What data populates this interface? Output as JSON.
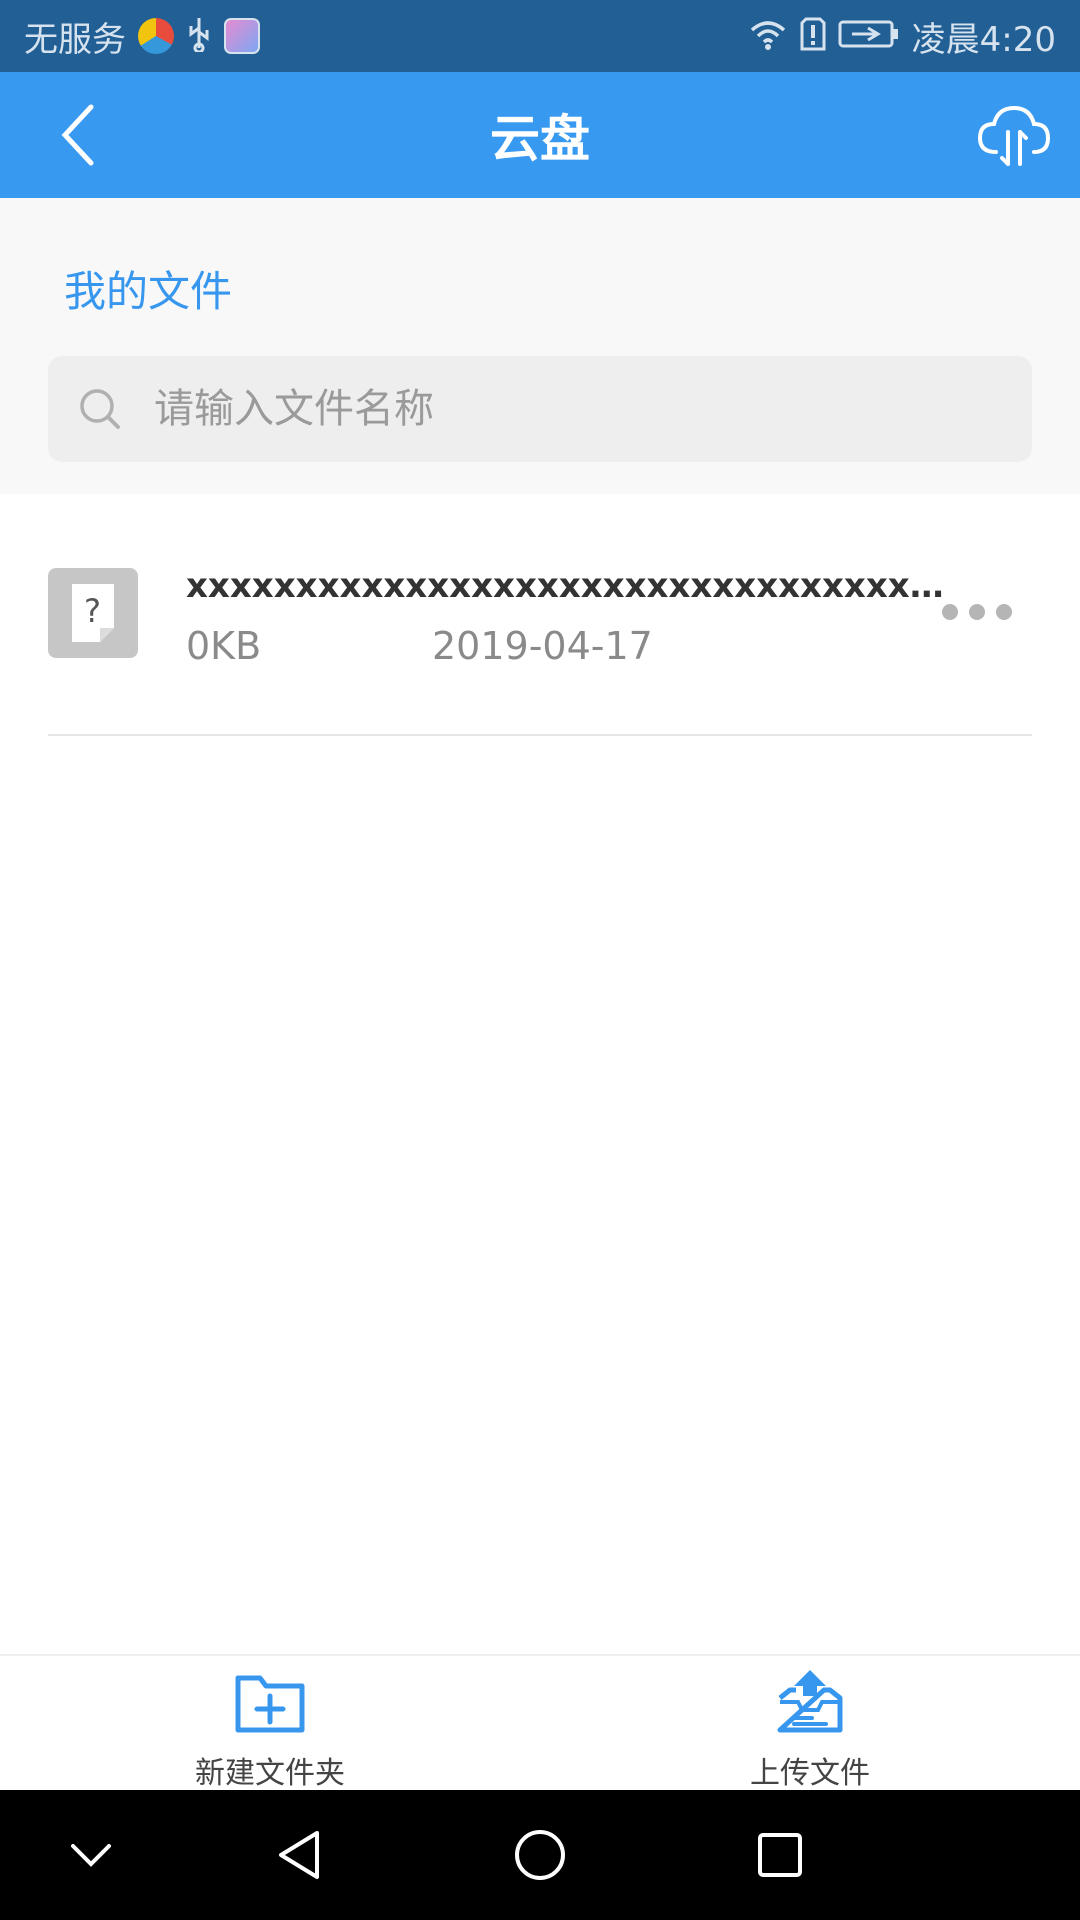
{
  "status_bar": {
    "carrier": "无服务",
    "time": "凌晨4:20"
  },
  "header": {
    "title": "云盘"
  },
  "section": {
    "title": "我的文件",
    "search_placeholder": "请输入文件名称"
  },
  "files": [
    {
      "name": "xxxxxxxxxxxxxxxxxxxxxxxxxxxxxxxxxx…",
      "size": "0KB",
      "date": "2019-04-17"
    }
  ],
  "toolbar": {
    "new_folder_label": "新建文件夹",
    "upload_label": "上传文件"
  },
  "colors": {
    "status_bar": "#215f95",
    "header": "#3799f0",
    "accent": "#3797ee"
  }
}
